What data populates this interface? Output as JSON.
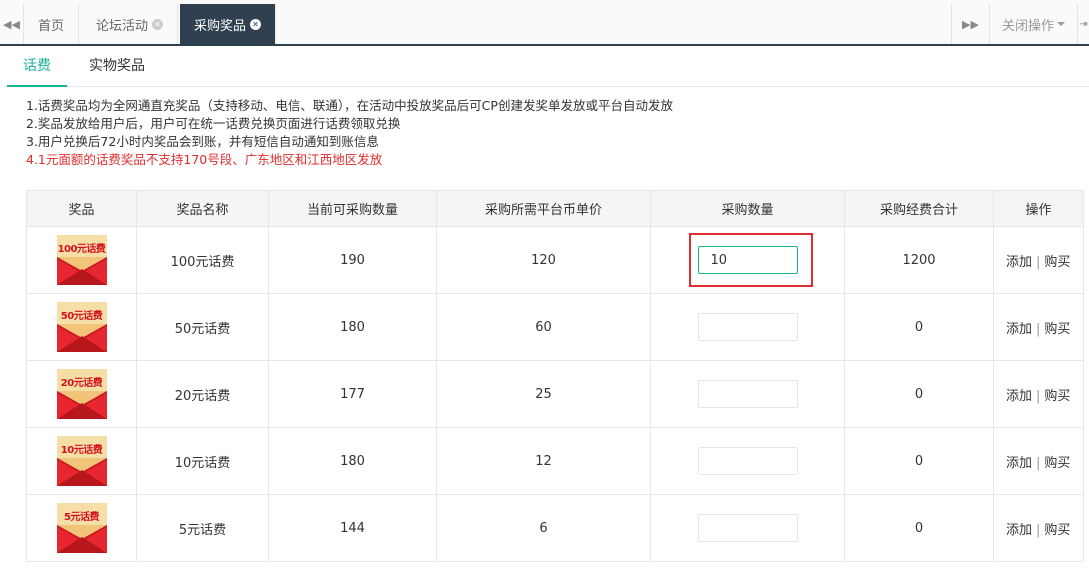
{
  "topbar": {
    "nav_left_icon": "double-chevron-left-icon",
    "tabs": [
      {
        "label": "首页",
        "closable": false,
        "active": false
      },
      {
        "label": "论坛活动",
        "closable": true,
        "active": false
      },
      {
        "label": "采购奖品",
        "closable": true,
        "active": true
      }
    ],
    "nav_right_icon": "double-chevron-right-icon",
    "close_ops_label": "关闭操作",
    "exit_icon": "exit-icon"
  },
  "subtabs": [
    {
      "label": "话费",
      "active": true
    },
    {
      "label": "实物奖品",
      "active": false
    }
  ],
  "notes": [
    "1.话费奖品均为全网通直充奖品（支持移动、电信、联通），在活动中投放奖品后可CP创建发奖单发放或平台自动发放",
    "2.奖品发放给用户后，用户可在统一话费兑换页面进行话费领取兑换",
    "3.用户兑换后72小时内奖品会到账，并有短信自动通知到账信息",
    "4.1元面额的话费奖品不支持170号段、广东地区和江西地区发放"
  ],
  "table": {
    "headers": [
      "奖品",
      "奖品名称",
      "当前可采购数量",
      "采购所需平台币单价",
      "采购数量",
      "采购经费合计",
      "操作"
    ],
    "rows": [
      {
        "img_label": "100元话费",
        "name": "100元话费",
        "available": "190",
        "unit_price": "120",
        "qty": "10",
        "total": "1200"
      },
      {
        "img_label": "50元话费",
        "name": "50元话费",
        "available": "180",
        "unit_price": "60",
        "qty": "",
        "total": "0"
      },
      {
        "img_label": "20元话费",
        "name": "20元话费",
        "available": "177",
        "unit_price": "25",
        "qty": "",
        "total": "0"
      },
      {
        "img_label": "10元话费",
        "name": "10元话费",
        "available": "180",
        "unit_price": "12",
        "qty": "",
        "total": "0"
      },
      {
        "img_label": "5元话费",
        "name": "5元话费",
        "available": "144",
        "unit_price": "6",
        "qty": "",
        "total": "0"
      }
    ],
    "add_label": "添加",
    "separator": "|",
    "buy_label": "购买"
  },
  "colors": {
    "accent": "#1ab394",
    "dark_nav": "#2f4050",
    "warning_red": "#e02d2d",
    "envelope_red": "#e8262f",
    "envelope_top": "#f6dfa6"
  }
}
